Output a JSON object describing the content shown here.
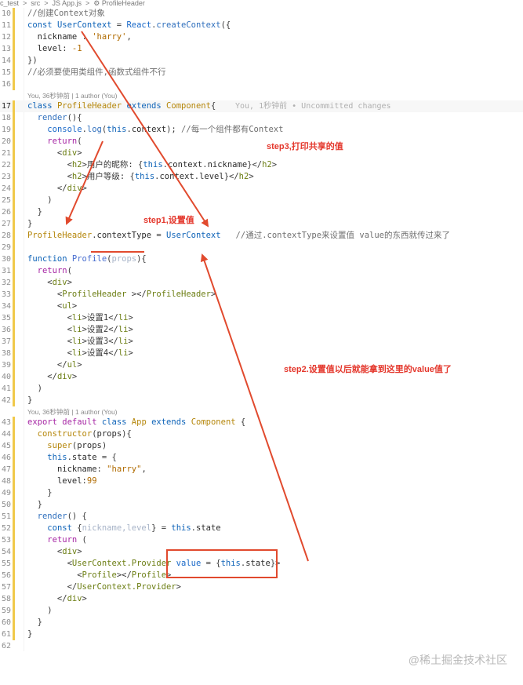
{
  "breadcrumb": "c_test  >  src  >  JS App.js  >  ⚙ ProfileHeader",
  "editor": {
    "blame_1": "You, 36秒钟前 | 1 author (You)",
    "blame_2": "You, 36秒钟前 | 1 author (You)",
    "blame_3": "You, 36秒钟前 | 1 author (You)",
    "inline_blame": "You, 1秒钟前 • Uncommitted changes",
    "lines": [
      {
        "n": "10",
        "code": "//创建Context对象"
      },
      {
        "n": "11",
        "code": "const UserContext = React.createContext({"
      },
      {
        "n": "12",
        "code": "  nickname : 'harry',"
      },
      {
        "n": "13",
        "code": "  level: -1"
      },
      {
        "n": "14",
        "code": "})"
      },
      {
        "n": "15",
        "code": "//必须要使用类组件,函数式组件不行"
      },
      {
        "n": "16",
        "code": ""
      },
      {
        "n": "17",
        "code": "class ProfileHeader extends Component{"
      },
      {
        "n": "18",
        "code": "  render(){"
      },
      {
        "n": "19",
        "code": "    console.log(this.context); //每一个组件都有Context"
      },
      {
        "n": "20",
        "code": "    return("
      },
      {
        "n": "21",
        "code": "      <div>"
      },
      {
        "n": "22",
        "code": "        <h2>用户的昵称: {this.context.nickname}</h2>"
      },
      {
        "n": "23",
        "code": "        <h2>用户等级: {this.context.level}</h2>"
      },
      {
        "n": "24",
        "code": "      </div>"
      },
      {
        "n": "25",
        "code": "    )"
      },
      {
        "n": "26",
        "code": "  }"
      },
      {
        "n": "27",
        "code": "}"
      },
      {
        "n": "28",
        "code": "ProfileHeader.contextType = UserContext   //通过.contextType来设置值 value的东西就传过来了"
      },
      {
        "n": "29",
        "code": ""
      },
      {
        "n": "30",
        "code": "function Profile(props){"
      },
      {
        "n": "31",
        "code": "  return("
      },
      {
        "n": "32",
        "code": "    <div>"
      },
      {
        "n": "33",
        "code": "      <ProfileHeader ></ProfileHeader>"
      },
      {
        "n": "34",
        "code": "      <ul>"
      },
      {
        "n": "35",
        "code": "        <li>设置1</li>"
      },
      {
        "n": "36",
        "code": "        <li>设置2</li>"
      },
      {
        "n": "37",
        "code": "        <li>设置3</li>"
      },
      {
        "n": "38",
        "code": "        <li>设置4</li>"
      },
      {
        "n": "39",
        "code": "      </ul>"
      },
      {
        "n": "40",
        "code": "    </div>"
      },
      {
        "n": "41",
        "code": "  )"
      },
      {
        "n": "42",
        "code": "}"
      },
      {
        "n": "43",
        "code": "export default class App extends Component {"
      },
      {
        "n": "44",
        "code": "  constructor(props){"
      },
      {
        "n": "45",
        "code": "    super(props)"
      },
      {
        "n": "46",
        "code": "    this.state = {"
      },
      {
        "n": "47",
        "code": "      nickname: \"harry\","
      },
      {
        "n": "48",
        "code": "      level:99"
      },
      {
        "n": "49",
        "code": "    }"
      },
      {
        "n": "50",
        "code": "  }"
      },
      {
        "n": "51",
        "code": "  render() {"
      },
      {
        "n": "52",
        "code": "    const {nickname,level} = this.state"
      },
      {
        "n": "53",
        "code": "    return ("
      },
      {
        "n": "54",
        "code": "      <div>"
      },
      {
        "n": "55",
        "code": "        <UserContext.Provider value = {this.state}>"
      },
      {
        "n": "56",
        "code": "          <Profile></Profile>"
      },
      {
        "n": "57",
        "code": "        </UserContext.Provider>"
      },
      {
        "n": "58",
        "code": "      </div>"
      },
      {
        "n": "59",
        "code": "    )"
      },
      {
        "n": "60",
        "code": "  }"
      },
      {
        "n": "61",
        "code": "}"
      },
      {
        "n": "62",
        "code": ""
      }
    ]
  },
  "annotations": {
    "step3": "step3,打印共享的值",
    "step1": "step1,设置值",
    "step2": "step2.设置值以后就能拿到这里的value值了",
    "color": "#e4372c"
  },
  "watermark": "@稀土掘金技术社区"
}
